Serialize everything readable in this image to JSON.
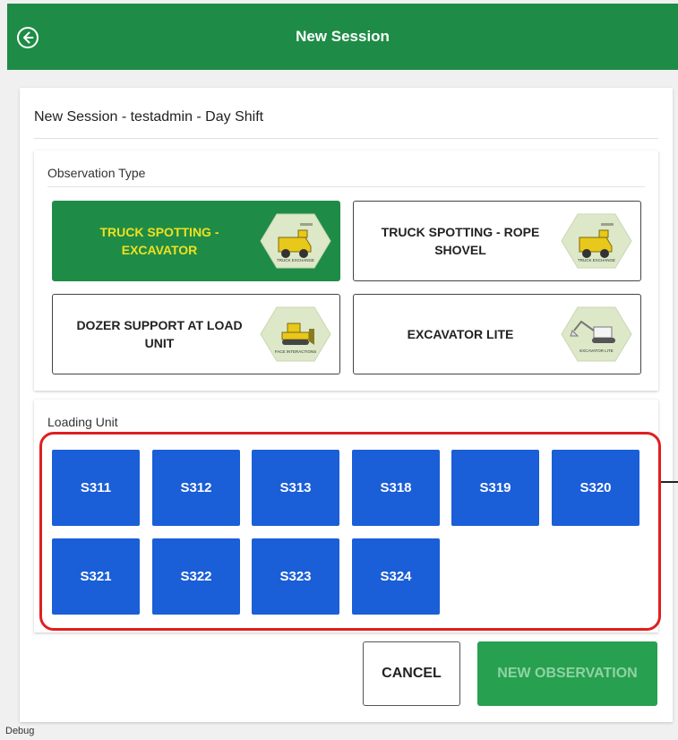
{
  "header": {
    "title": "New Session",
    "back_icon": "arrow-left-circle-icon",
    "color": "#1e8c46"
  },
  "session": {
    "title": "New Session - testadmin - Day Shift"
  },
  "observation_type": {
    "label": "Observation Type",
    "options": [
      {
        "label": "TRUCK SPOTTING - EXCAVATOR",
        "badge_text": "TRUCK EXCHANGE",
        "badge_icon": "dump-truck-icon",
        "selected": true
      },
      {
        "label": "TRUCK SPOTTING - ROPE SHOVEL",
        "badge_text": "TRUCK EXCHANGE",
        "badge_icon": "dump-truck-icon",
        "selected": false
      },
      {
        "label": "DOZER SUPPORT AT LOAD UNIT",
        "badge_text": "FACE INTERACTIONS",
        "badge_icon": "dozer-icon",
        "selected": false
      },
      {
        "label": "EXCAVATOR LITE",
        "badge_text": "EXCAVATOR LITE",
        "badge_icon": "excavator-icon",
        "selected": false
      }
    ]
  },
  "loading_unit": {
    "label": "Loading Unit",
    "units": [
      "S311",
      "S312",
      "S313",
      "S318",
      "S319",
      "S320",
      "S321",
      "S322",
      "S323",
      "S324"
    ],
    "button_color": "#1a5ed8"
  },
  "actions": {
    "cancel_label": "CANCEL",
    "new_observation_label": "NEW OBSERVATION",
    "new_observation_enabled": false
  },
  "footer": {
    "debug_label": "Debug"
  },
  "annotation": {
    "highlight_color": "#e01f1f"
  }
}
